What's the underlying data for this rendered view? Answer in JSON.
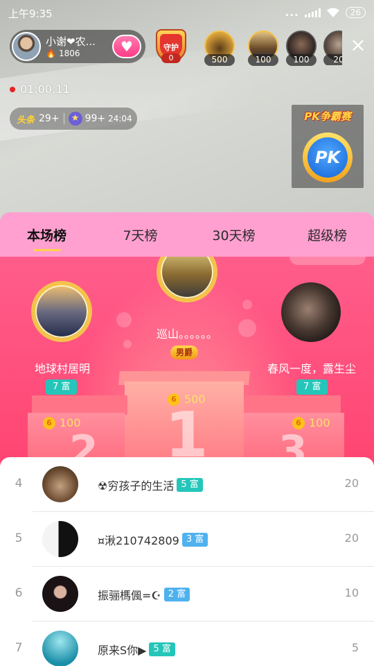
{
  "status_bar": {
    "time": "上午9:35",
    "dots": "...",
    "battery": "26"
  },
  "anchor": {
    "name": "小谢❤农...",
    "heat": "1806",
    "heat_icon": "flame-icon",
    "follow_icon": "heart-hands-icon"
  },
  "top_viewers": {
    "guard_label": "守护",
    "guard_count": "0",
    "viewers": [
      {
        "count": "500"
      },
      {
        "count": "100"
      },
      {
        "count": "100"
      },
      {
        "count": "20"
      }
    ]
  },
  "live_timer": "01:00:11",
  "rank_bar": {
    "toutiao_label": "头条",
    "toutiao_rank": "29+",
    "star_rank": "99+",
    "time": "24:04"
  },
  "pk": {
    "title": "PK争霸赛",
    "label": "PK"
  },
  "tabs": [
    {
      "label": "本场榜",
      "active": true
    },
    {
      "label": "7天榜",
      "active": false
    },
    {
      "label": "30天榜",
      "active": false
    },
    {
      "label": "超级榜",
      "active": false
    }
  ],
  "podium": {
    "first": {
      "name": "巡山。。。。。。",
      "title": "男爵",
      "score": "500",
      "place": "1"
    },
    "second": {
      "name": "地球村居明",
      "level": "7 富",
      "score": "100",
      "place": "2"
    },
    "third": {
      "name": "春风一度，露生尘",
      "level": "7 富",
      "score": "100",
      "place": "3"
    }
  },
  "list": [
    {
      "rank": "4",
      "name": "☢穷孩子的生活",
      "level": "5 富",
      "level_color": "#25c6b9",
      "score": "20"
    },
    {
      "rank": "5",
      "name": "¤湫210742809",
      "level": "3 富",
      "level_color": "#4fb2ef",
      "score": "20"
    },
    {
      "rank": "6",
      "name": "振骊榪偑=☪",
      "level": "2 富",
      "level_color": "#4fb2ef",
      "score": "10"
    },
    {
      "rank": "7",
      "name": "原来S你▶",
      "level": "5 富",
      "level_color": "#25c6b9",
      "score": "5"
    }
  ]
}
